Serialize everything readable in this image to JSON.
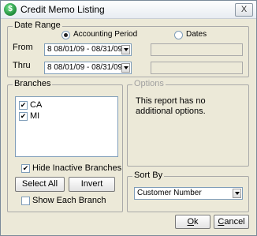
{
  "window": {
    "title": "Credit Memo Listing",
    "close_label": "X"
  },
  "date_range": {
    "group_label": "Date Range",
    "radio_accounting": "Accounting Period",
    "radio_dates": "Dates",
    "from_label": "From",
    "thru_label": "Thru",
    "from_value": "8  08/01/09 - 08/31/09",
    "thru_value": "8  08/01/09 - 08/31/09"
  },
  "branches": {
    "group_label": "Branches",
    "items": [
      {
        "label": "CA",
        "checked": true
      },
      {
        "label": "MI",
        "checked": true
      }
    ],
    "hide_inactive_label": "Hide Inactive Branches",
    "select_all_label": "Select All",
    "invert_label": "Invert",
    "show_each_label": "Show Each Branch"
  },
  "options": {
    "group_label": "Options",
    "message": "This report has no additional options."
  },
  "sort_by": {
    "group_label": "Sort By",
    "value": "Customer Number"
  },
  "buttons": {
    "ok_prefix": "",
    "ok_underline": "O",
    "ok_rest": "k",
    "cancel_prefix": "",
    "cancel_underline": "C",
    "cancel_rest": "ancel"
  }
}
